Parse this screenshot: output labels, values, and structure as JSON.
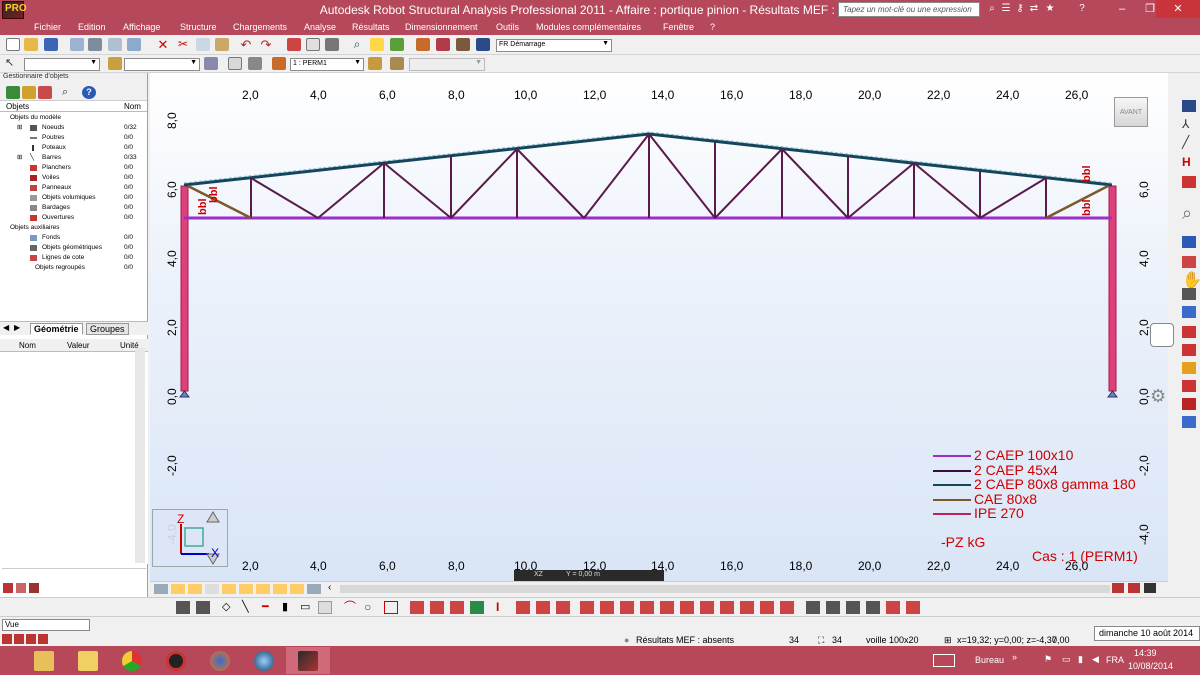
{
  "window": {
    "title": "Autodesk Robot Structural Analysis Professional 2011 - Affaire : portique pinion - Résultats MEF : absents",
    "search_placeholder": "Tapez un mot-clé ou une expression",
    "app_badge": "PRO"
  },
  "menu": [
    "Fichier",
    "Edition",
    "Affichage",
    "Structure",
    "Chargements",
    "Analyse",
    "Résultats",
    "Dimensionnement",
    "Outils",
    "Modules complémentaires",
    "Fenêtre",
    "?"
  ],
  "toolbar": {
    "layout_combo": "Démarrage",
    "layout_prefix": "FR",
    "case_combo": "1 : PERM1"
  },
  "object_manager": {
    "header": "Gestionnaire d'objets",
    "col_objects": "Objets",
    "col_count": "Nom",
    "tree": [
      {
        "label": "Objets du modèle",
        "value": "",
        "level": 0
      },
      {
        "label": "Noeuds",
        "value": "0/32",
        "level": 1
      },
      {
        "label": "Poutres",
        "value": "0/0",
        "level": 1
      },
      {
        "label": "Poteaux",
        "value": "0/0",
        "level": 1
      },
      {
        "label": "Barres",
        "value": "0/33",
        "level": 1
      },
      {
        "label": "Planchers",
        "value": "0/0",
        "level": 1
      },
      {
        "label": "Voiles",
        "value": "0/0",
        "level": 1
      },
      {
        "label": "Panneaux",
        "value": "0/0",
        "level": 1
      },
      {
        "label": "Objets volumiques",
        "value": "0/0",
        "level": 1
      },
      {
        "label": "Bardages",
        "value": "0/0",
        "level": 1
      },
      {
        "label": "Ouvertures",
        "value": "0/0",
        "level": 1
      },
      {
        "label": "Objets auxiliaires",
        "value": "",
        "level": 0
      },
      {
        "label": "Fonds",
        "value": "0/0",
        "level": 1
      },
      {
        "label": "Objets géométriques",
        "value": "0/0",
        "level": 1
      },
      {
        "label": "Lignes de cote",
        "value": "0/0",
        "level": 1
      },
      {
        "label": "Objets regroupés",
        "value": "0/0",
        "level": 1
      }
    ],
    "tabs": [
      "Géométrie",
      "Groupes"
    ],
    "props_cols": [
      "Nom",
      "Valeur",
      "Unité"
    ]
  },
  "view": {
    "x_ticks": [
      "2,0",
      "4,0",
      "6,0",
      "8,0",
      "10,0",
      "12,0",
      "14,0",
      "16,0",
      "18,0",
      "20,0",
      "22,0",
      "24,0",
      "26,0"
    ],
    "y_ticks": [
      "8,0",
      "6,0",
      "4,0",
      "2,0",
      "0,0",
      "-2,0",
      "-4,0"
    ],
    "avant_label": "AVANT",
    "section_labels": [
      "bbl",
      "bbl",
      "bbl",
      "bbl"
    ],
    "legend": [
      {
        "label": "2 CAEP 100x10",
        "color": "#9b30c8"
      },
      {
        "label": "2 CAEP 45x4",
        "color": "#3b0a3f"
      },
      {
        "label": "2 CAEP 80x8 gamma 180",
        "color": "#15455a"
      },
      {
        "label": "CAE 80x8",
        "color": "#7a5a2a"
      },
      {
        "label": "IPE 270",
        "color": "#b8245e"
      }
    ],
    "pz_label": "-PZ kG",
    "case_label": "Cas : 1 (PERM1)",
    "axis_z": "Z",
    "axis_x": "X",
    "plane_label": "XZ",
    "y_readout": "Y = 0,00 m"
  },
  "status": {
    "vue_input": "Vue",
    "fem_results": "Résultats MEF : absents",
    "nodes": "34",
    "bars": "34",
    "section": "voille 100x20",
    "coords": "x=19,32; y=0,00; z=-4,37",
    "angle": "0,00",
    "date_tip": "dimanche 10 août 2014"
  },
  "taskbar": {
    "desktop": "Bureau",
    "lang": "FRA",
    "time": "14:39",
    "date": "10/08/2014"
  }
}
